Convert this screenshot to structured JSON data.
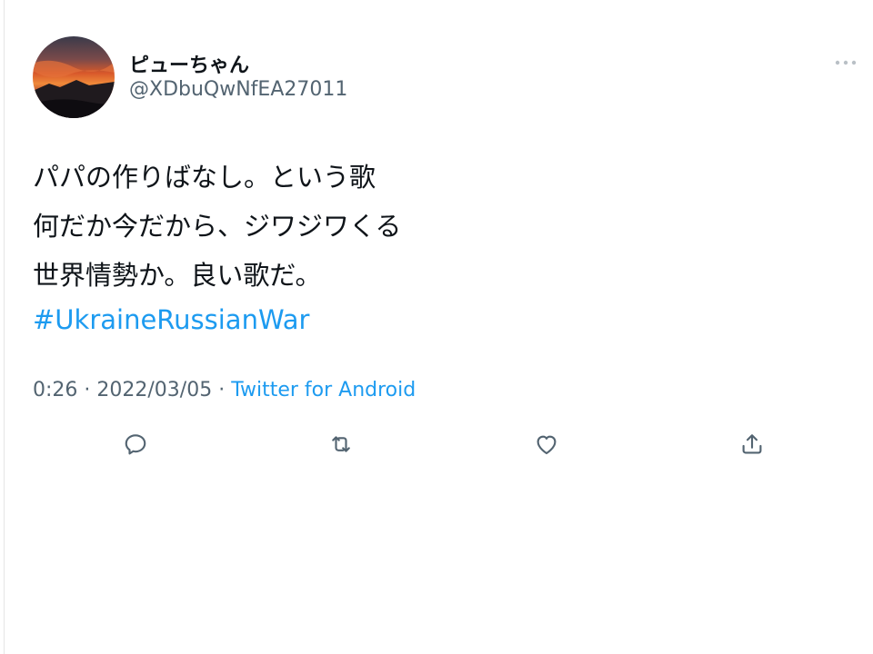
{
  "user": {
    "display_name": "ピューちゃん",
    "handle": "@XDbuQwNfEA27011"
  },
  "tweet": {
    "text_lines": [
      "パパの作りばなし。という歌",
      "何だか今だから、ジワジワくる",
      "世界情勢か。良い歌だ。"
    ],
    "hashtag": "#UkraineRussianWar"
  },
  "meta": {
    "time": "0:26",
    "separator": " · ",
    "date": "2022/03/05",
    "source": "Twitter for Android"
  },
  "icons": {
    "more": "more-horizontal-icon",
    "reply": "reply-icon",
    "retweet": "retweet-icon",
    "like": "heart-icon",
    "share": "share-icon"
  },
  "colors": {
    "text": "#0f1419",
    "secondary": "#536471",
    "link": "#1d9bf0",
    "icon": "#536471"
  }
}
